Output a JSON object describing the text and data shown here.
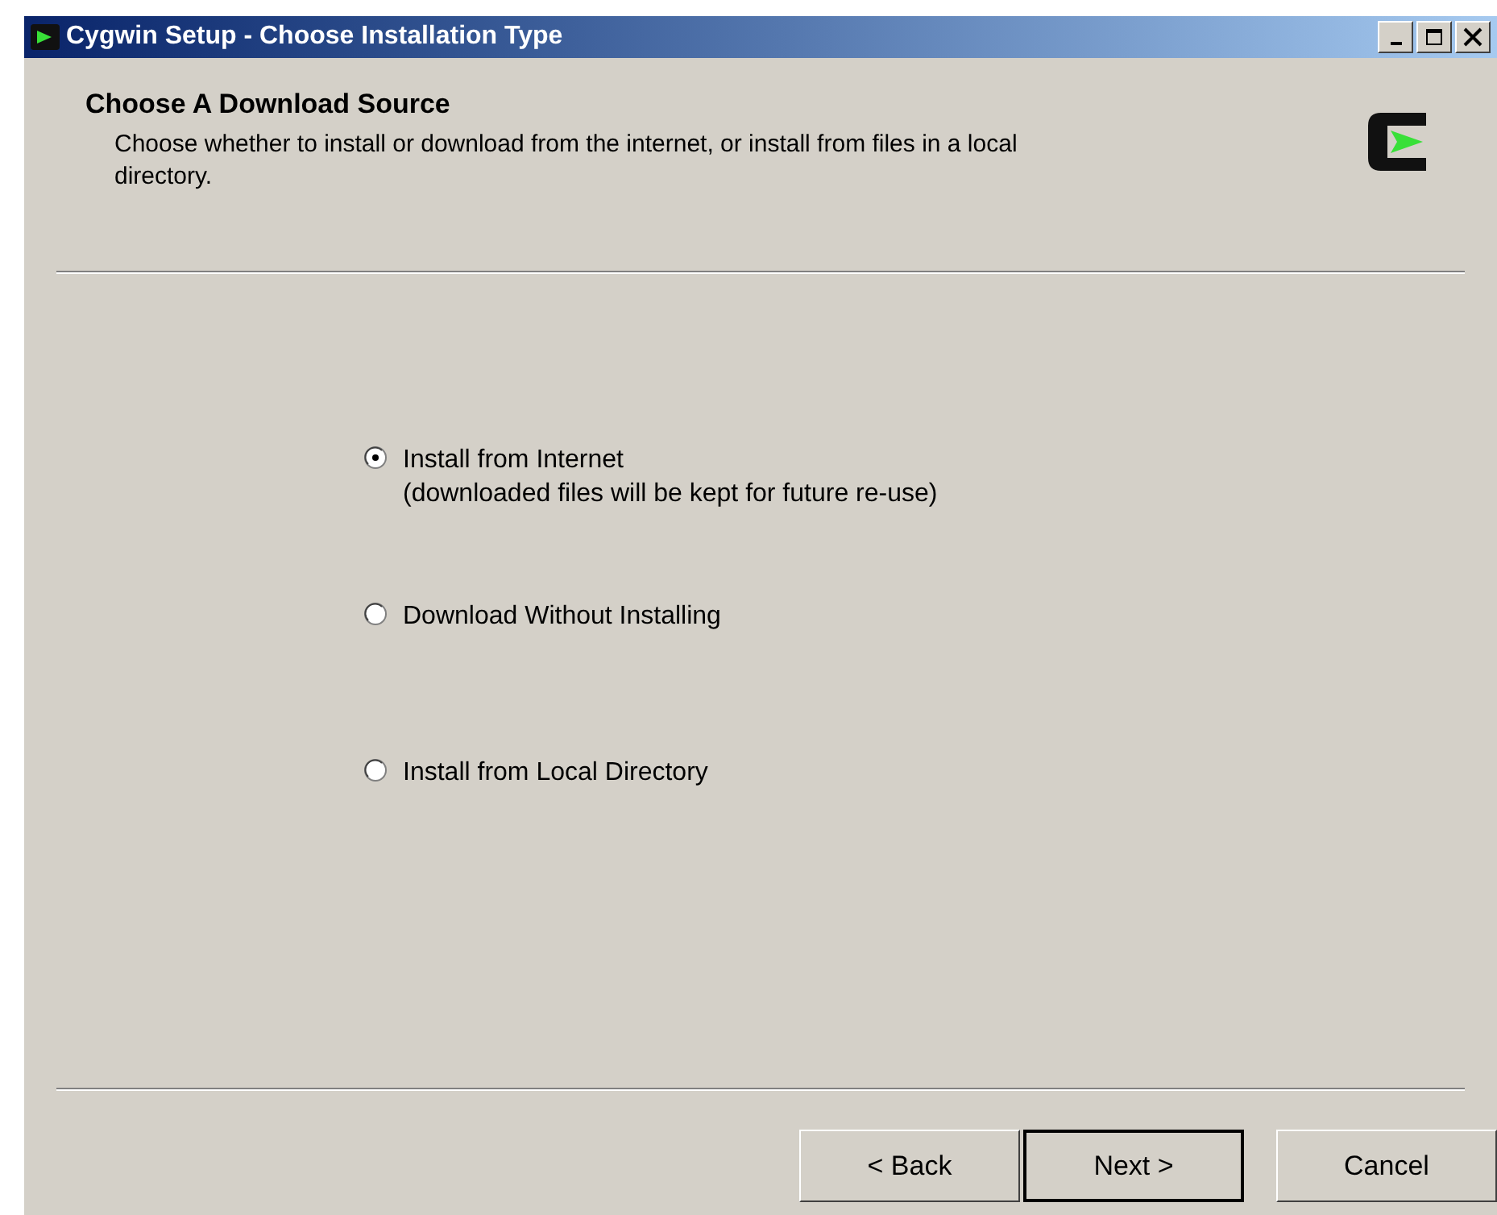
{
  "window": {
    "title": "Cygwin Setup - Choose Installation Type"
  },
  "header": {
    "title": "Choose A Download Source",
    "description": "Choose whether to install or download from the internet, or install from files in a local directory."
  },
  "options": [
    {
      "label": "Install from Internet",
      "note": "(downloaded files will be kept for future re-use)",
      "selected": true
    },
    {
      "label": "Download Without Installing",
      "selected": false
    },
    {
      "label": "Install from Local Directory",
      "selected": false
    }
  ],
  "buttons": [
    {
      "label": "< Back",
      "default": false
    },
    {
      "label": "Next >",
      "default": true
    },
    {
      "label": "Cancel",
      "default": false
    }
  ]
}
